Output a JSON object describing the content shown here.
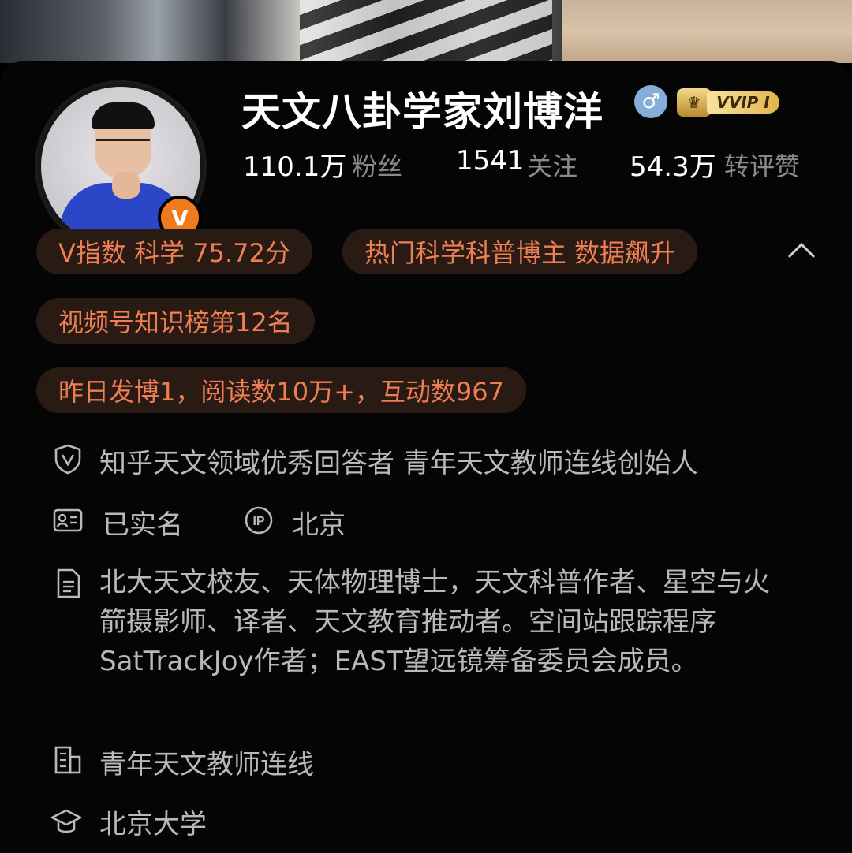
{
  "profile": {
    "name": "天文八卦学家刘博洋",
    "gender_symbol": "♂",
    "verified_symbol": "V",
    "vip_label": "VVIP I"
  },
  "stats": {
    "followers_value": "110.1万",
    "followers_label": "粉丝",
    "following_value": "1541",
    "following_label": "关注",
    "engagement_value": "54.3万",
    "engagement_label": "转评赞"
  },
  "tags": [
    "V指数 科学 75.72分",
    "热门科学科普博主 数据飙升",
    "视频号知识榜第12名",
    "昨日发博1，阅读数10万+，互动数967"
  ],
  "info": {
    "verification": "知乎天文领域优秀回答者 青年天文教师连线创始人",
    "real_name": "已实名",
    "ip_location": "北京",
    "bio": "北大天文校友、天体物理博士，天文科普作者、星空与火箭摄影师、译者、天文教育推动者。空间站跟踪程序SatTrackJoy作者；EAST望远镜筹备委员会成员。",
    "company": "青年天文教师连线",
    "school": "北京大学"
  },
  "colors": {
    "background": "#000000",
    "chip_bg": "#2a1a14",
    "chip_text": "#ee7f54",
    "verified_orange": "#f07a1e",
    "gender_blue": "#86aedb"
  }
}
